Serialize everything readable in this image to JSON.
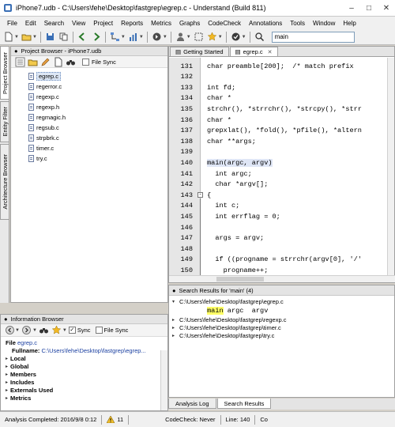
{
  "window": {
    "title": "iPhone7.udb - C:\\Users\\fehe\\Desktop\\fastgrep\\egrep.c - Understand (Build 811)"
  },
  "menu": [
    "File",
    "Edit",
    "Search",
    "View",
    "Project",
    "Reports",
    "Metrics",
    "Graphs",
    "CodeCheck",
    "Annotations",
    "Tools",
    "Window",
    "Help"
  ],
  "toolbar": {
    "search_value": "main"
  },
  "vertical_tabs": [
    "Project Browser",
    "Entity Filter",
    "Architecture Browser"
  ],
  "project_browser": {
    "title": "Project Browser - iPhone7.udb",
    "file_sync_label": "File Sync",
    "files": [
      "egrep.c",
      "regerror.c",
      "regexp.c",
      "regexp.h",
      "regmagic.h",
      "regsub.c",
      "strpbrk.c",
      "timer.c",
      "try.c"
    ]
  },
  "info_browser": {
    "title": "Information Browser",
    "sync_label": "Sync",
    "file_sync_label": "File Sync",
    "file_label": "File",
    "file_name": "egrep.c",
    "fullname_label": "Fullname:",
    "fullname_value": "C:\\Users\\fehe\\Desktop\\fastgrep\\egrep...",
    "sections": [
      "Local",
      "Global",
      "Members",
      "Includes",
      "Externals Used",
      "Metrics"
    ]
  },
  "editor": {
    "tabs": [
      {
        "label": "Getting Started"
      },
      {
        "label": "egrep.c"
      }
    ],
    "lines": [
      {
        "n": "131",
        "text": "char preamble[200];  /* match prefix"
      },
      {
        "n": "132",
        "text": ""
      },
      {
        "n": "133",
        "text": "int fd;"
      },
      {
        "n": "134",
        "text": "char *"
      },
      {
        "n": "135",
        "text": "strchr(), *strrchr(), *strcpy(), *strr"
      },
      {
        "n": "136",
        "text": "char *"
      },
      {
        "n": "137",
        "text": "grepxlat(), *fold(), *pfile(), *altern"
      },
      {
        "n": "138",
        "text": "char **args;"
      },
      {
        "n": "139",
        "text": ""
      },
      {
        "n": "140",
        "text": "main(argc, argv)"
      },
      {
        "n": "141",
        "text": "  int argc;"
      },
      {
        "n": "142",
        "text": "  char *argv[];"
      },
      {
        "n": "143",
        "text": "{"
      },
      {
        "n": "144",
        "text": "  int c;"
      },
      {
        "n": "145",
        "text": "  int errflag = 0;"
      },
      {
        "n": "146",
        "text": ""
      },
      {
        "n": "147",
        "text": "  args = argv;"
      },
      {
        "n": "148",
        "text": ""
      },
      {
        "n": "149",
        "text": "  if ((progname = strrchr(argv[0], '/'"
      },
      {
        "n": "150",
        "text": "    progname++;"
      }
    ]
  },
  "search_results": {
    "title": "Search Results for 'main' (4)",
    "results": [
      {
        "path": "C:\\Users\\fehe\\Desktop\\fastgrep\\egrep.c",
        "expanded": true
      },
      {
        "path": "C:\\Users\\fehe\\Desktop\\fastgrep\\regexp.c",
        "expanded": false
      },
      {
        "path": "C:\\Users\\fehe\\Desktop\\fastgrep\\timer.c",
        "expanded": false
      },
      {
        "path": "C:\\Users\\fehe\\Desktop\\fastgrep\\try.c",
        "expanded": false
      }
    ],
    "match_hit": "main",
    "match_rest": " argc  argv"
  },
  "bottom_tabs": [
    "Analysis Log",
    "Search Results"
  ],
  "status": {
    "analysis": "Analysis Completed: 2016/9/8 0:12",
    "warnings": "11",
    "codecheck": "CodeCheck: Never",
    "line": "Line: 140",
    "col": "Co"
  },
  "colors": {
    "selection": "#dde7f5",
    "search_highlight": "#ffff66",
    "gutter": "#e6e6e6"
  }
}
